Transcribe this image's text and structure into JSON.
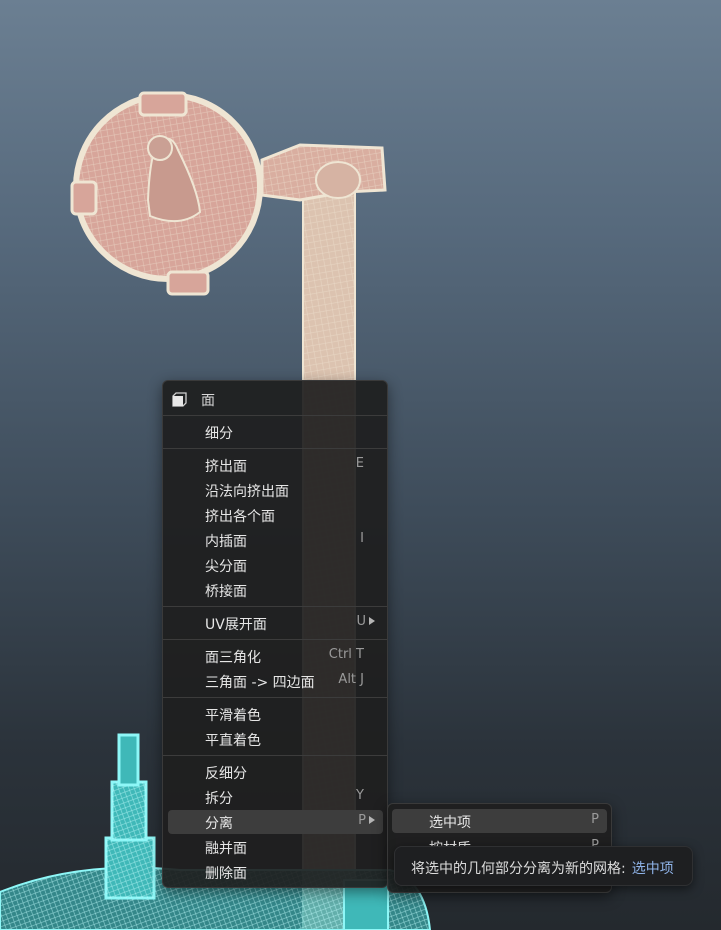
{
  "menu": {
    "title": "面",
    "icon": "face-icon",
    "items": [
      {
        "label": "细分",
        "shortcut": ""
      },
      {
        "label": "挤出面",
        "shortcut": "E"
      },
      {
        "label": "沿法向挤出面",
        "shortcut": ""
      },
      {
        "label": "挤出各个面",
        "shortcut": ""
      },
      {
        "label": "内插面",
        "shortcut": "I"
      },
      {
        "label": "尖分面",
        "shortcut": ""
      },
      {
        "label": "桥接面",
        "shortcut": ""
      },
      {
        "label": "UV展开面",
        "shortcut": "U",
        "submenu": true
      },
      {
        "label": "面三角化",
        "shortcut": "Ctrl T"
      },
      {
        "label": "三角面 -> 四边面",
        "shortcut": "Alt J"
      },
      {
        "label": "平滑着色",
        "shortcut": ""
      },
      {
        "label": "平直着色",
        "shortcut": ""
      },
      {
        "label": "反细分",
        "shortcut": ""
      },
      {
        "label": "拆分",
        "shortcut": "Y"
      },
      {
        "label": "分离",
        "shortcut": "P",
        "submenu": true,
        "active": true
      },
      {
        "label": "融并面",
        "shortcut": ""
      },
      {
        "label": "删除面",
        "shortcut": ""
      }
    ]
  },
  "submenu": {
    "items": [
      {
        "label": "选中项",
        "shortcut": "P",
        "active": true
      },
      {
        "label": "按材质",
        "shortcut": "P"
      }
    ]
  },
  "tooltip": {
    "text": "将选中的几何部分分离为新的网格:",
    "value": "选中项"
  },
  "colors": {
    "menu_bg": "#1e1e1e",
    "highlight": "#3d3d3d",
    "tooltip_value": "#8fb3e8",
    "mesh_wire": "#e6dcc8",
    "mesh_face": "#d9aea0",
    "selected_wire": "#6ff0f0"
  }
}
